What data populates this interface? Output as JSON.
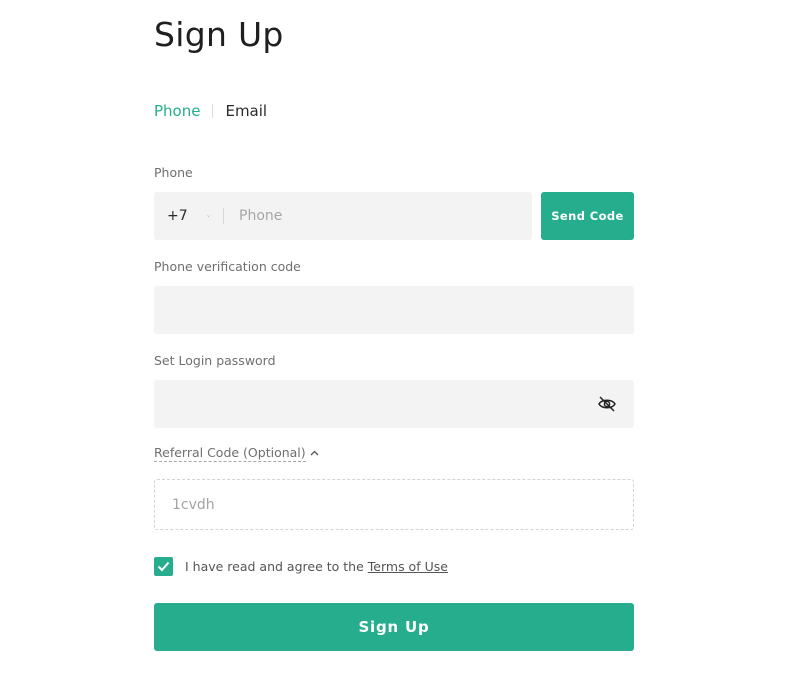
{
  "page": {
    "title": "Sign Up"
  },
  "tabs": [
    {
      "label": "Phone",
      "active": true
    },
    {
      "label": "Email",
      "active": false
    }
  ],
  "phone": {
    "label": "Phone",
    "country_code": "+7",
    "placeholder": "Phone",
    "send_code_label": "Send Code"
  },
  "verification": {
    "label": "Phone verification code",
    "value": ""
  },
  "password": {
    "label": "Set Login password",
    "value": "",
    "toggle_icon": "eye-off-icon"
  },
  "referral": {
    "toggle_label": "Referral Code (Optional)",
    "expanded": true,
    "value": "1cvdh"
  },
  "agreement": {
    "checked": true,
    "text": "I have read and agree to the",
    "link_text": "Terms of Use"
  },
  "submit": {
    "label": "Sign Up"
  },
  "colors": {
    "accent": "#25ad8e",
    "field_bg": "#f3f3f3",
    "label": "#6f6f6f"
  }
}
